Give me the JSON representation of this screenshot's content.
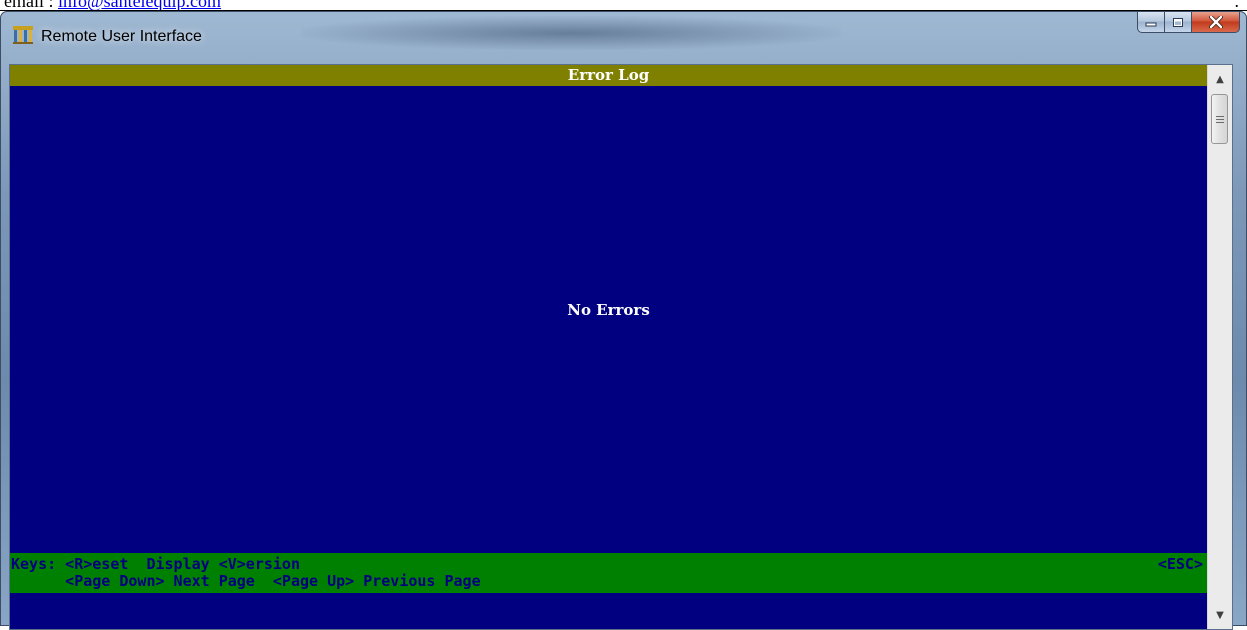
{
  "document": {
    "label": "email",
    "separator": ":",
    "email": "info@santelequip.com",
    "trailing": "."
  },
  "window": {
    "title": "Remote User Interface",
    "icons": {
      "app": "app-grid-icon",
      "minimize": "minimize-icon",
      "maximize": "maximize-icon",
      "close": "close-icon"
    }
  },
  "terminal": {
    "header": "Error Log",
    "message": "No Errors",
    "keys_line1": "Keys: <R>eset  Display <V>ersion",
    "keys_esc": "<ESC>",
    "keys_line2": "      <Page Down> Next Page  <Page Up> Previous Page"
  },
  "scrollbar": {
    "up_glyph": "▲",
    "down_glyph": "▼"
  },
  "colors": {
    "terminal_bg": "#000080",
    "header_bg": "#808000",
    "keys_bg": "#008000",
    "keys_text": "#000080"
  }
}
